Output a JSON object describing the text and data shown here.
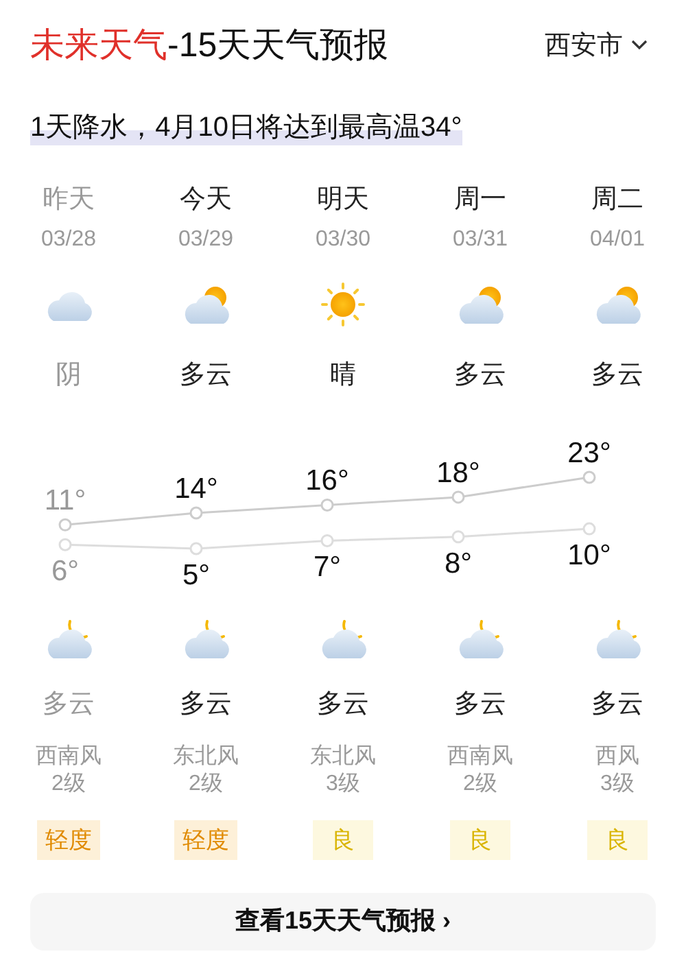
{
  "header": {
    "title_brand": "未来天气",
    "title_rest": "-15天天气预报",
    "city": "西安市"
  },
  "summary": "1天降水，4月10日将达到最高温34°",
  "days": [
    {
      "label": "昨天",
      "date": "03/28",
      "past": true,
      "day": {
        "kind": "cloudy",
        "condition": "阴"
      },
      "night": {
        "kind": "cloudy_night",
        "condition": "多云"
      },
      "wind": "西南风",
      "wind_level": "2级",
      "aqi": {
        "kind": "light",
        "text": "轻度"
      }
    },
    {
      "label": "今天",
      "date": "03/29",
      "past": false,
      "day": {
        "kind": "partly_cloudy",
        "condition": "多云"
      },
      "night": {
        "kind": "cloudy_night",
        "condition": "多云"
      },
      "wind": "东北风",
      "wind_level": "2级",
      "aqi": {
        "kind": "light",
        "text": "轻度"
      }
    },
    {
      "label": "明天",
      "date": "03/30",
      "past": false,
      "day": {
        "kind": "sunny",
        "condition": "晴"
      },
      "night": {
        "kind": "cloudy_night",
        "condition": "多云"
      },
      "wind": "东北风",
      "wind_level": "3级",
      "aqi": {
        "kind": "good",
        "text": "良"
      }
    },
    {
      "label": "周一",
      "date": "03/31",
      "past": false,
      "day": {
        "kind": "partly_cloudy",
        "condition": "多云"
      },
      "night": {
        "kind": "cloudy_night",
        "condition": "多云"
      },
      "wind": "西南风",
      "wind_level": "2级",
      "aqi": {
        "kind": "good",
        "text": "良"
      }
    },
    {
      "label": "周二",
      "date": "04/01",
      "past": false,
      "day": {
        "kind": "partly_cloudy",
        "condition": "多云"
      },
      "night": {
        "kind": "cloudy_night",
        "condition": "多云"
      },
      "wind": "西风",
      "wind_level": "3级",
      "aqi": {
        "kind": "good",
        "text": "良"
      }
    }
  ],
  "temperatures": {
    "high": [
      "11°",
      "14°",
      "16°",
      "18°",
      "23°"
    ],
    "low": [
      "6°",
      "5°",
      "7°",
      "8°",
      "10°"
    ]
  },
  "more_button": "查看15天天气预报 ›"
}
